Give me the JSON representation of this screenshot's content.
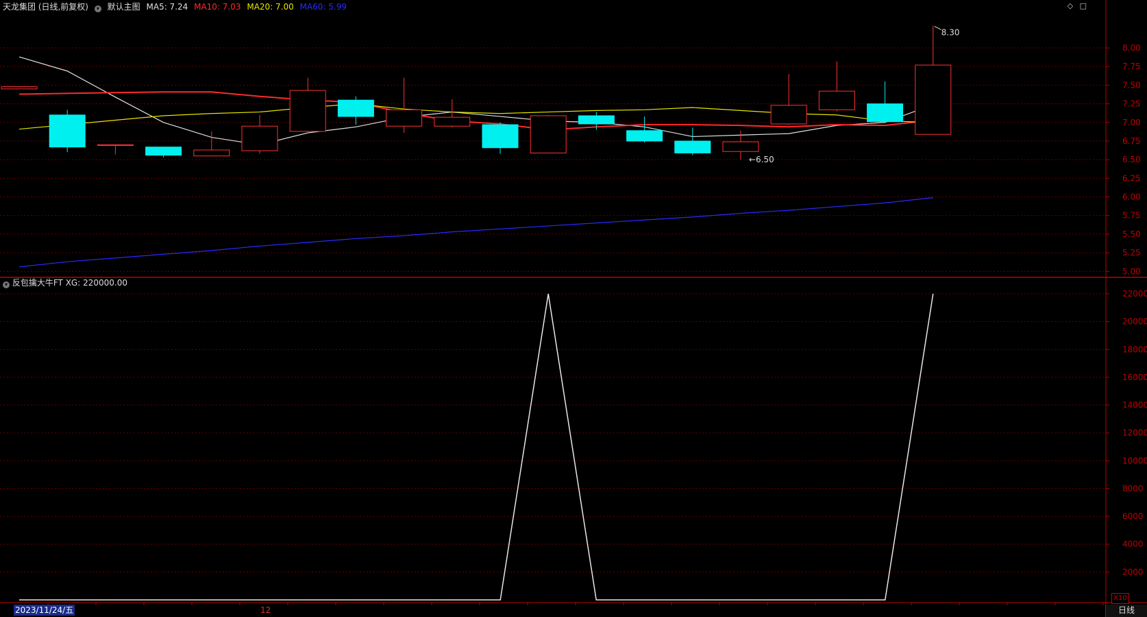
{
  "header": {
    "stock_title": "天龙集团 (日线,前复权)",
    "template_name": "默认主图",
    "ma_labels": [
      {
        "text": "MA5: 7.24",
        "color": "#e0e0e0"
      },
      {
        "text": "MA10: 7.03",
        "color": "#ff2a2a"
      },
      {
        "text": "MA20: 7.00",
        "color": "#e6e600"
      },
      {
        "text": "MA60: 5.99",
        "color": "#2a2aff"
      }
    ],
    "window_icons": [
      "diamond-icon",
      "restore-icon"
    ]
  },
  "indicator": {
    "name": "反包擒大牛FT",
    "value_label": "XG: 220000.00",
    "multiplier_badge": "X10"
  },
  "footer": {
    "current_date": "2023/11/24/五",
    "month_label": "12",
    "period": "日线"
  },
  "colors": {
    "up": "#ff3232",
    "down": "#00f0f0",
    "grid": "#6b0000",
    "axis": "#c00000",
    "ma5": "#e0e0e0",
    "ma10": "#ff2a2a",
    "ma20": "#e6e600",
    "ma60": "#2a2aff"
  },
  "chart_data": [
    {
      "type": "candlestick",
      "title": "天龙集团 (日线,前复权)",
      "y_ticks": [
        8.0,
        7.75,
        7.5,
        7.25,
        7.0,
        6.75,
        6.5,
        6.25,
        6.0,
        5.75,
        5.5,
        5.25,
        5.0
      ],
      "ylim": [
        4.92,
        8.46
      ],
      "annotations": [
        {
          "text": "8.30",
          "candle": 19,
          "value": 8.3
        },
        {
          "text": "←6.50",
          "candle": 15,
          "value": 6.5
        }
      ],
      "candles": [
        {
          "open": 7.45,
          "close": 7.48,
          "high": 7.48,
          "low": 7.45
        },
        {
          "open": 7.1,
          "close": 6.67,
          "high": 7.17,
          "low": 6.6
        },
        {
          "open": 6.7,
          "close": 6.7,
          "high": 6.7,
          "low": 6.57
        },
        {
          "open": 6.67,
          "close": 6.56,
          "high": 6.67,
          "low": 6.53
        },
        {
          "open": 6.55,
          "close": 6.63,
          "high": 6.88,
          "low": 6.55
        },
        {
          "open": 6.62,
          "close": 6.95,
          "high": 7.1,
          "low": 6.58
        },
        {
          "open": 6.88,
          "close": 7.43,
          "high": 7.6,
          "low": 6.85
        },
        {
          "open": 7.3,
          "close": 7.08,
          "high": 7.35,
          "low": 6.97
        },
        {
          "open": 6.95,
          "close": 7.17,
          "high": 7.6,
          "low": 6.86
        },
        {
          "open": 6.95,
          "close": 7.07,
          "high": 7.31,
          "low": 6.93
        },
        {
          "open": 6.97,
          "close": 6.66,
          "high": 7.0,
          "low": 6.58
        },
        {
          "open": 6.59,
          "close": 7.09,
          "high": 7.1,
          "low": 6.59
        },
        {
          "open": 7.09,
          "close": 6.98,
          "high": 7.14,
          "low": 6.9
        },
        {
          "open": 6.89,
          "close": 6.75,
          "high": 7.08,
          "low": 6.73
        },
        {
          "open": 6.75,
          "close": 6.59,
          "high": 6.93,
          "low": 6.56
        },
        {
          "open": 6.61,
          "close": 6.74,
          "high": 6.89,
          "low": 6.5
        },
        {
          "open": 6.98,
          "close": 7.23,
          "high": 7.65,
          "low": 6.97
        },
        {
          "open": 7.17,
          "close": 7.42,
          "high": 7.82,
          "low": 7.15
        },
        {
          "open": 7.25,
          "close": 7.01,
          "high": 7.55,
          "low": 6.99
        },
        {
          "open": 6.84,
          "close": 7.77,
          "high": 8.3,
          "low": 6.84
        }
      ],
      "series": [
        {
          "name": "MA5",
          "values": [
            7.88,
            7.69,
            7.34,
            7.0,
            6.8,
            6.7,
            6.86,
            6.94,
            7.07,
            7.14,
            7.08,
            7.02,
            7.0,
            6.94,
            6.81,
            6.83,
            6.85,
            6.96,
            7.0,
            7.24
          ]
        },
        {
          "name": "MA10",
          "values": [
            7.38,
            7.39,
            7.4,
            7.41,
            7.41,
            7.35,
            7.3,
            7.27,
            7.13,
            7.02,
            6.98,
            6.9,
            6.94,
            6.97,
            6.97,
            6.96,
            6.94,
            6.97,
            6.96,
            7.03
          ]
        },
        {
          "name": "MA20",
          "values": [
            6.91,
            6.97,
            7.03,
            7.09,
            7.12,
            7.14,
            7.2,
            7.25,
            7.18,
            7.14,
            7.12,
            7.14,
            7.16,
            7.17,
            7.2,
            7.16,
            7.12,
            7.1,
            7.02,
            7.0
          ]
        },
        {
          "name": "MA60",
          "values": [
            5.06,
            5.13,
            5.18,
            5.23,
            5.28,
            5.34,
            5.39,
            5.44,
            5.48,
            5.53,
            5.57,
            5.61,
            5.65,
            5.69,
            5.73,
            5.78,
            5.82,
            5.87,
            5.92,
            5.99
          ]
        }
      ]
    },
    {
      "type": "line",
      "title": "反包擒大牛FT",
      "y_ticks": [
        22000,
        20000,
        18000,
        16000,
        14000,
        12000,
        10000,
        8000,
        6000,
        4000,
        2000
      ],
      "ylim": [
        0,
        22000
      ],
      "series": [
        {
          "name": "XG",
          "values": [
            0,
            0,
            0,
            0,
            0,
            0,
            0,
            0,
            0,
            0,
            0,
            22000,
            0,
            0,
            0,
            0,
            0,
            0,
            0,
            22000
          ]
        }
      ]
    }
  ]
}
